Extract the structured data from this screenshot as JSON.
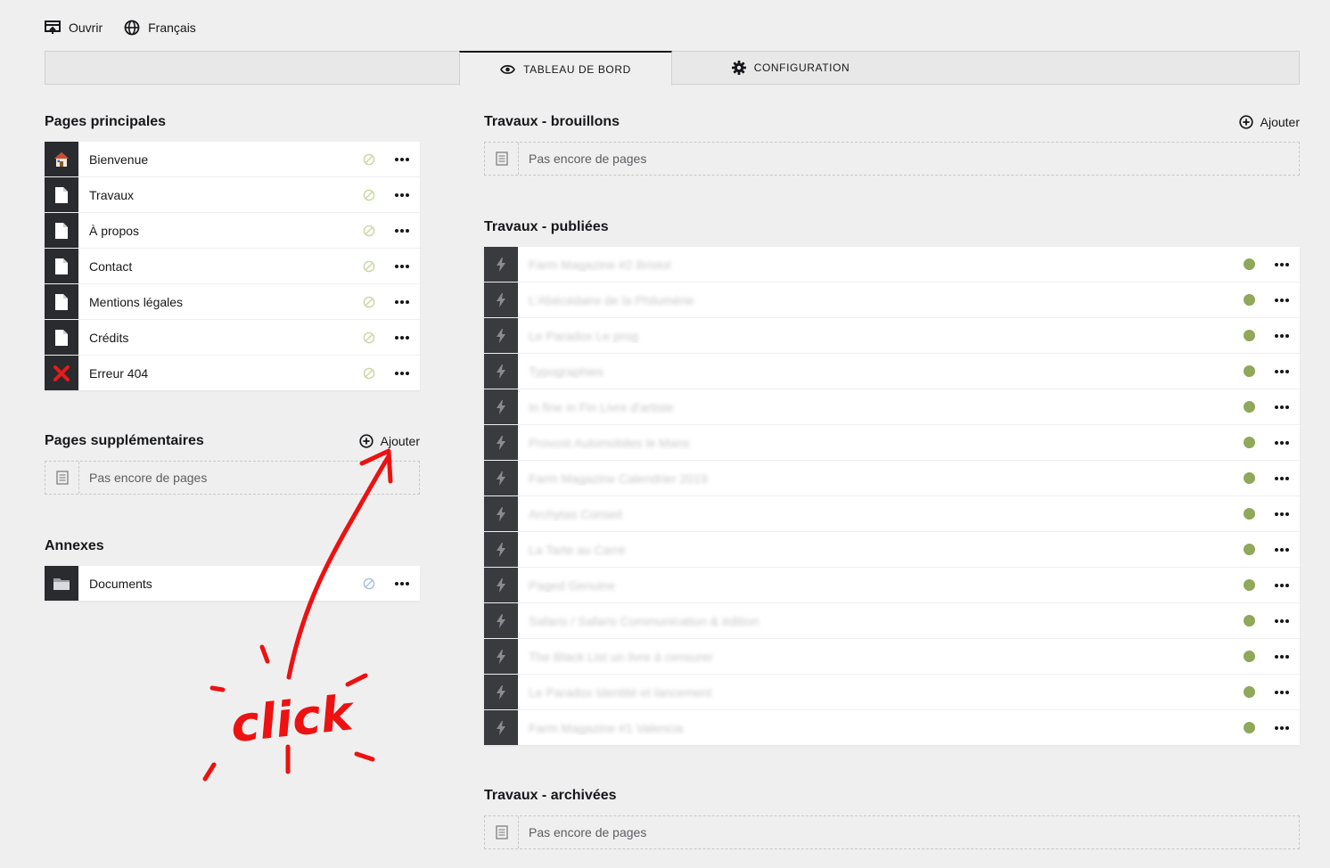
{
  "topbar": {
    "open_label": "Ouvrir",
    "language_label": "Français"
  },
  "tabs": {
    "dashboard_label": "TABLEAU DE BORD",
    "config_label": "CONFIGURATION"
  },
  "main_pages": {
    "title": "Pages principales",
    "items": [
      {
        "label": "Bienvenue",
        "icon": "home-icon"
      },
      {
        "label": "Travaux",
        "icon": "page-icon"
      },
      {
        "label": "À propos",
        "icon": "page-icon"
      },
      {
        "label": "Contact",
        "icon": "page-icon"
      },
      {
        "label": "Mentions légales",
        "icon": "page-icon"
      },
      {
        "label": "Crédits",
        "icon": "page-icon"
      },
      {
        "label": "Erreur 404",
        "icon": "error-icon"
      }
    ]
  },
  "extra_pages": {
    "title": "Pages supplémentaires",
    "add_label": "Ajouter",
    "empty_label": "Pas encore de pages"
  },
  "annexes": {
    "title": "Annexes",
    "items": [
      {
        "label": "Documents",
        "icon": "folder-icon"
      }
    ]
  },
  "drafts": {
    "title": "Travaux - brouillons",
    "add_label": "Ajouter",
    "empty_label": "Pas encore de pages"
  },
  "published": {
    "title": "Travaux - publiées",
    "items": [
      {
        "label": "Farm Magazine #2 Bristol"
      },
      {
        "label": "L'Abécédaire de la Philumérie"
      },
      {
        "label": "Le Paradox Le prog"
      },
      {
        "label": "Typographies"
      },
      {
        "label": "In fine in Fin Livre d'artiste"
      },
      {
        "label": "Provost Automobiles le Mans"
      },
      {
        "label": "Farm Magazine Calendrier 2019"
      },
      {
        "label": "Archytas Conseil"
      },
      {
        "label": "La Tarte au Carré"
      },
      {
        "label": "Paged Genuine"
      },
      {
        "label": "Safaris / Safaris Communication & édition"
      },
      {
        "label": "The Black List un livre à censurer"
      },
      {
        "label": "Le Paradox Identité et lancement"
      },
      {
        "label": "Farm Magazine #1 Valencia"
      }
    ]
  },
  "archived": {
    "title": "Travaux - archivées",
    "empty_label": "Pas encore de pages"
  },
  "annotation": {
    "text": "click",
    "color": "#ee1111"
  },
  "colors": {
    "status_published": "#8fa85a",
    "status_unlisted": "#c8d8a0",
    "thumb_bg": "#2a2b2f"
  }
}
